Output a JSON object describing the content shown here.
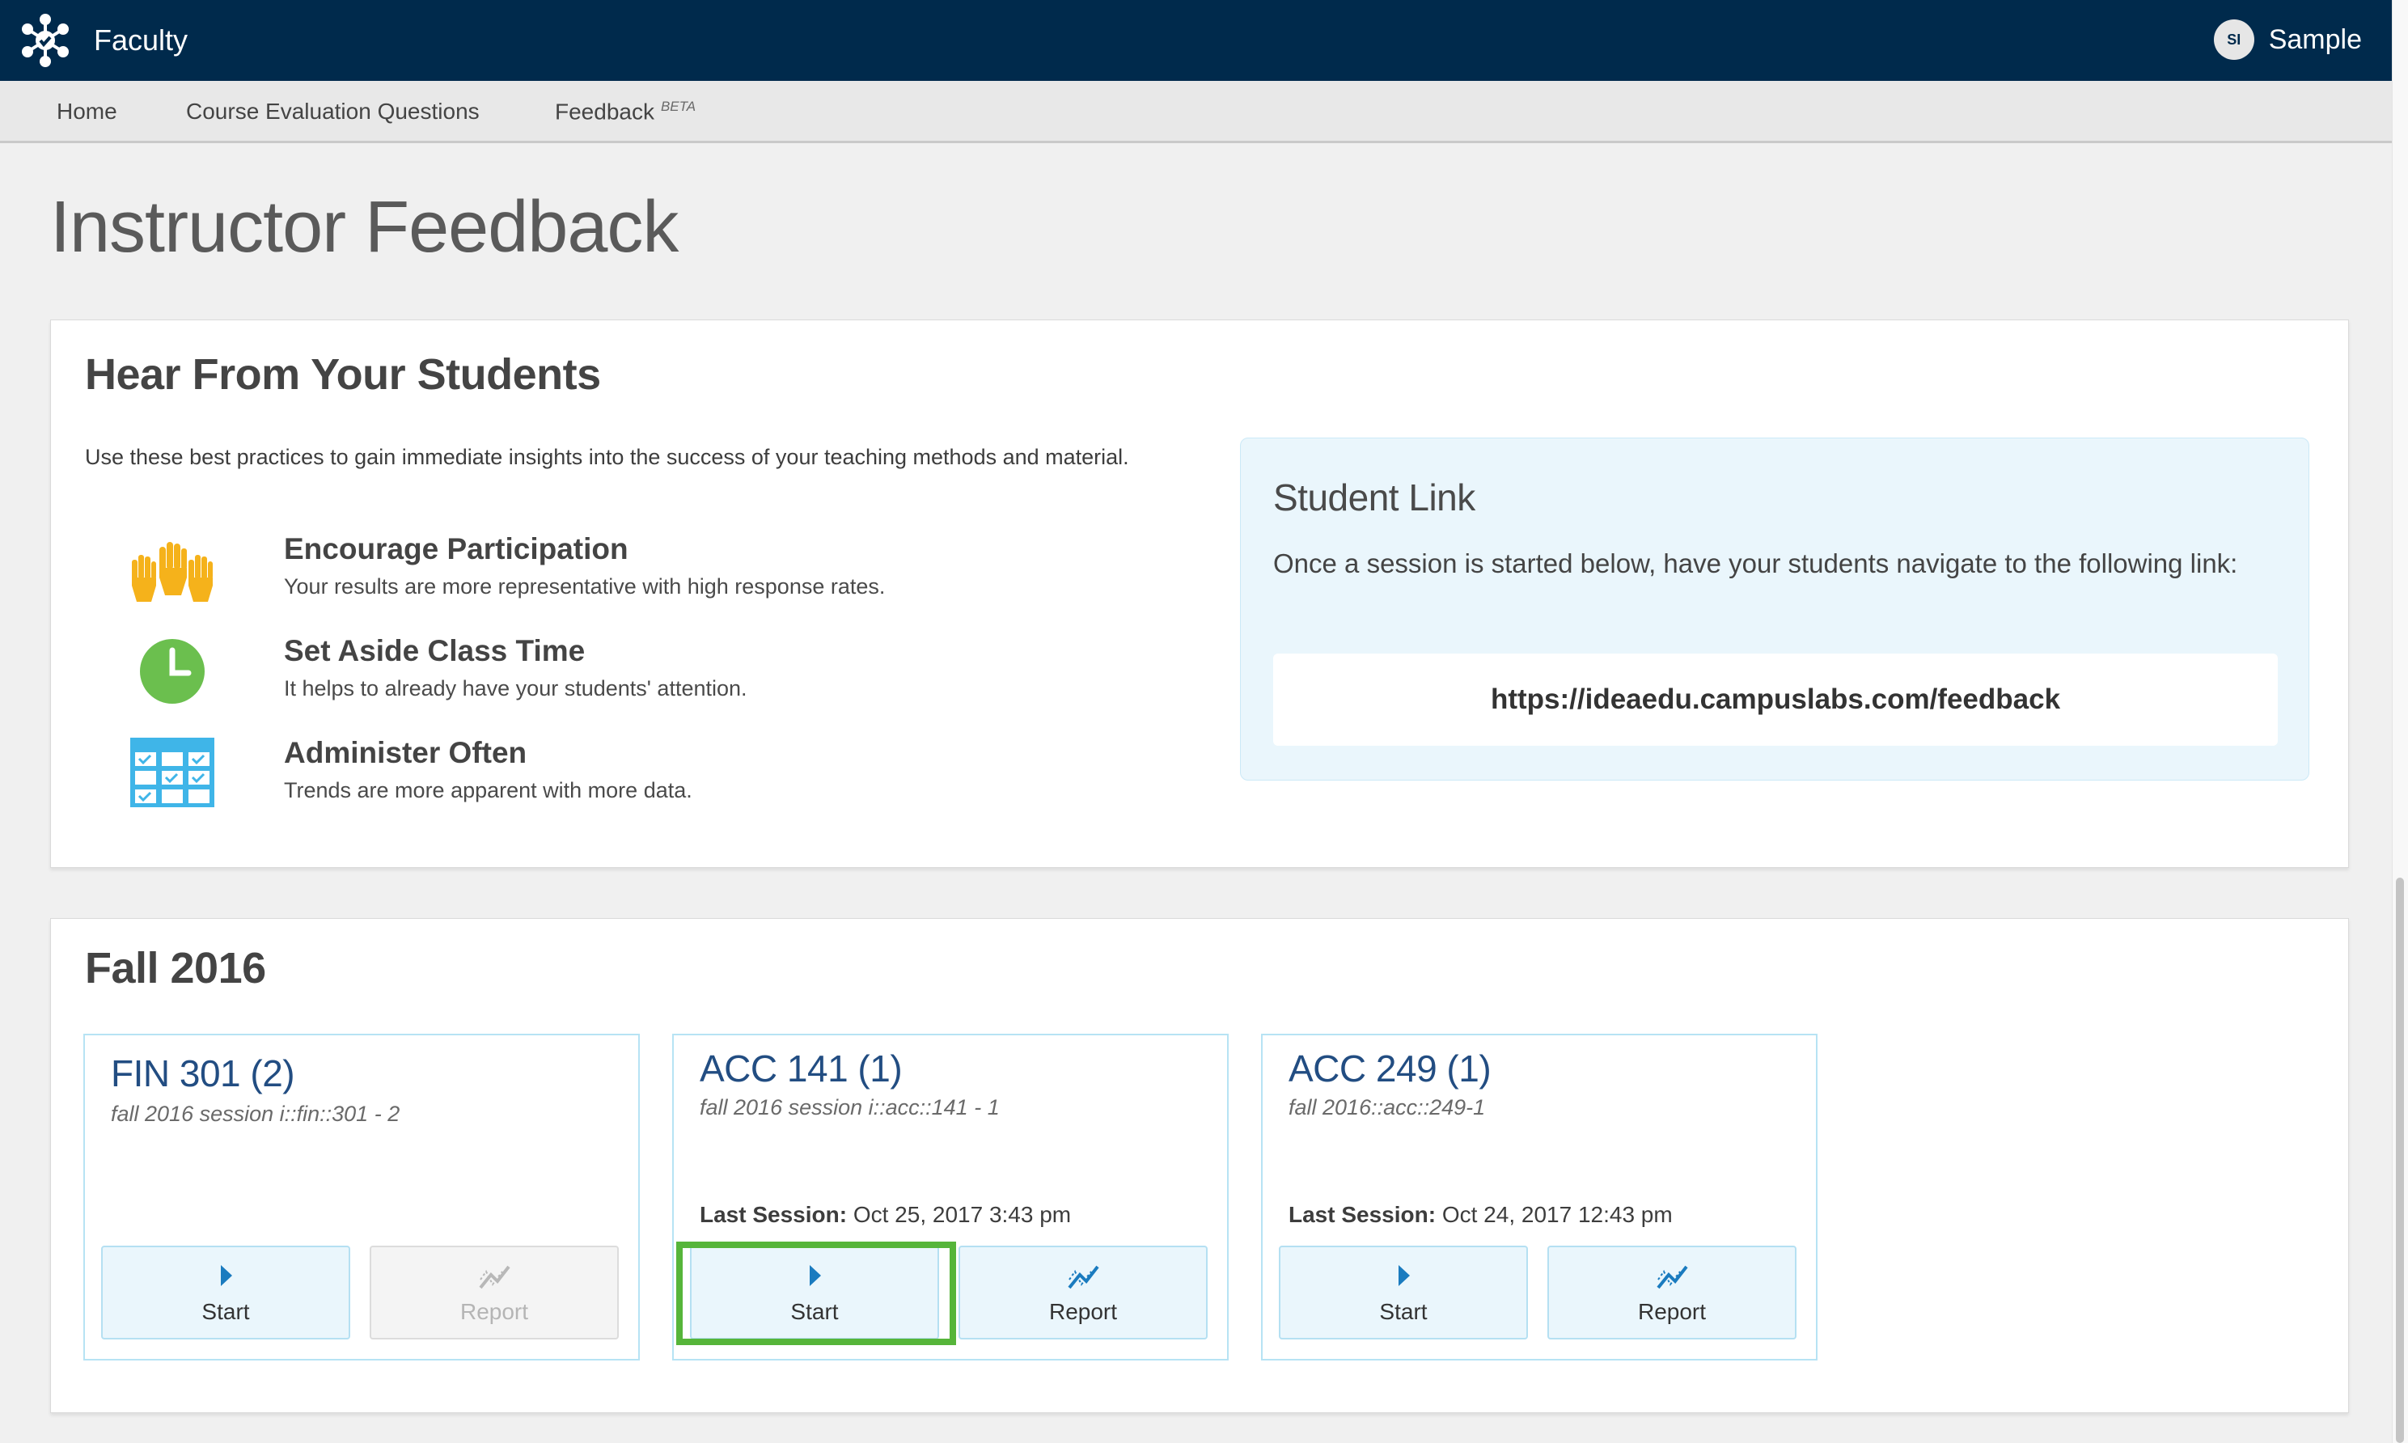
{
  "topbar": {
    "brand_name": "Faculty",
    "logo_icon": "network-hub-icon",
    "user_initials": "SI",
    "user_name": "Sample",
    "background": "#002a4c"
  },
  "subnav": {
    "items": [
      {
        "label": "Home"
      },
      {
        "label": "Course Evaluation Questions"
      },
      {
        "label": "Feedback",
        "badge": "BETA"
      }
    ]
  },
  "page_title": "Instructor Feedback",
  "intro_panel": {
    "heading": "Hear From Your Students",
    "intro_text": "Use these best practices to gain immediate insights into the success of your teaching methods and material.",
    "tips": [
      {
        "title": "Encourage Participation",
        "text": "Your results are more representative with high response rates.",
        "icon": "raised-hands-icon"
      },
      {
        "title": "Set Aside Class Time",
        "text": "It helps to already have your students' attention.",
        "icon": "clock-icon"
      },
      {
        "title": "Administer Often",
        "text": "Trends are more apparent with more data.",
        "icon": "calendar-grid-icon"
      }
    ],
    "student_link": {
      "title": "Student Link",
      "description": "Once a session is started below, have your students navigate to the following link:",
      "url": "https://ideaedu.campuslabs.com/feedback"
    }
  },
  "term_panel": {
    "heading": "Fall 2016",
    "courses": [
      {
        "title": "FIN 301 (2)",
        "subtitle": "fall 2016 session i::fin::301 - 2",
        "last_session_label": "",
        "last_session_value": "",
        "start_label": "Start",
        "report_label": "Report",
        "report_enabled": false
      },
      {
        "title": "ACC 141 (1)",
        "subtitle": "fall 2016 session i::acc::141 - 1",
        "last_session_label": "Last Session:",
        "last_session_value": "Oct 25, 2017 3:43 pm",
        "start_label": "Start",
        "report_label": "Report",
        "report_enabled": true
      },
      {
        "title": "ACC 249 (1)",
        "subtitle": "fall 2016::acc::249-1",
        "last_session_label": "Last Session:",
        "last_session_value": "Oct 24, 2017 12:43 pm",
        "start_label": "Start",
        "report_label": "Report",
        "report_enabled": true
      }
    ]
  },
  "colors": {
    "accent_blue": "#1a7bbf",
    "card_border": "#b7e3f4",
    "highlight_green": "#56b53a",
    "hands_yellow": "#f5b21b",
    "clock_green": "#6bbf4e",
    "calendar_blue": "#3fb5e8"
  },
  "icons": {
    "start": "play-icon",
    "report": "trend-chart-icon"
  }
}
